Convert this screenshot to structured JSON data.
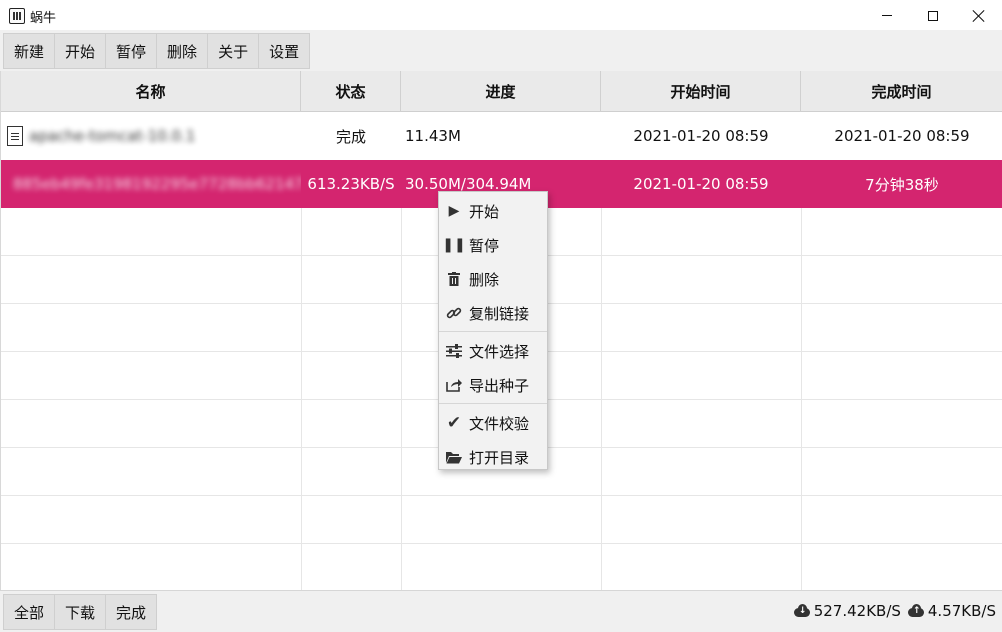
{
  "window": {
    "title": "蜗牛"
  },
  "toolbar": {
    "buttons": [
      "新建",
      "开始",
      "暂停",
      "删除",
      "关于",
      "设置"
    ]
  },
  "table": {
    "headers": [
      "名称",
      "状态",
      "进度",
      "开始时间",
      "完成时间"
    ],
    "rows": [
      {
        "name": "apache-tomcat-10.0.1",
        "status": "完成",
        "progress": "11.43M",
        "start": "2021-01-20 08:59",
        "finish": "2021-01-20 08:59",
        "selected": false
      },
      {
        "name": "885eb49fe3198192295e7728bb62147",
        "status": "613.23KB/S",
        "progress": "30.50M/304.94M",
        "start": "2021-01-20 08:59",
        "finish": "7分钟38秒",
        "selected": true
      }
    ],
    "selected_color": "#d4256f"
  },
  "context_menu": {
    "items": [
      {
        "label": "开始",
        "icon": "play-icon"
      },
      {
        "label": "暂停",
        "icon": "pause-icon"
      },
      {
        "label": "删除",
        "icon": "trash-icon"
      },
      {
        "label": "复制链接",
        "icon": "link-icon"
      },
      {
        "label": "文件选择",
        "icon": "sliders-icon"
      },
      {
        "label": "导出种子",
        "icon": "export-icon"
      },
      {
        "label": "文件校验",
        "icon": "check-icon"
      },
      {
        "label": "打开目录",
        "icon": "folder-open-icon"
      }
    ]
  },
  "statusbar": {
    "filters": [
      "全部",
      "下载",
      "完成"
    ],
    "download_speed": "527.42KB/S",
    "upload_speed": "4.57KB/S"
  }
}
